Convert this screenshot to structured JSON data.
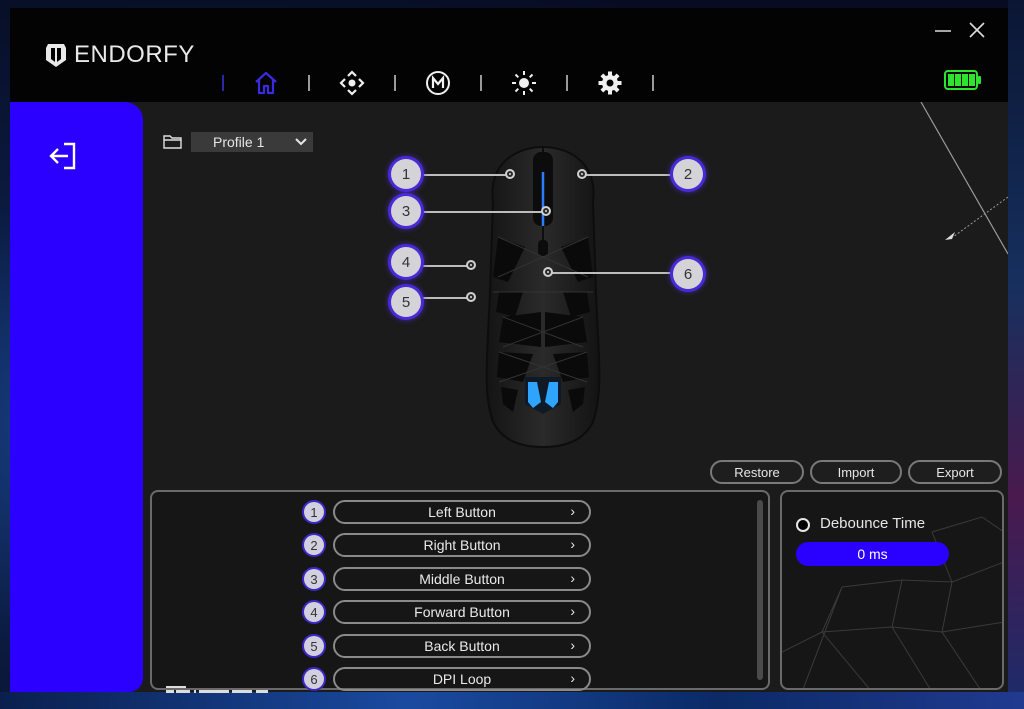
{
  "app": {
    "brand_name": "ENDORFY",
    "window_controls": {
      "minimize": "minimize-icon",
      "close": "close-icon"
    },
    "battery": {
      "icon": "battery-icon",
      "level_bars": 4,
      "level_total": 4,
      "color": "#2ee52e"
    }
  },
  "nav": {
    "items": [
      {
        "id": "home",
        "icon": "home-icon",
        "active": true
      },
      {
        "id": "dpi",
        "icon": "dpi-move-icon",
        "active": false
      },
      {
        "id": "macro",
        "icon": "macro-m-icon",
        "active": false
      },
      {
        "id": "lighting",
        "icon": "brightness-icon",
        "active": false
      },
      {
        "id": "settings",
        "icon": "gear-icon",
        "active": false
      }
    ],
    "active_color": "#3a2be0"
  },
  "sidebar": {
    "exit_icon": "exit-icon",
    "color": "#2b00ff"
  },
  "profile": {
    "icon": "folder-icon",
    "selected": "Profile 1"
  },
  "mouse_callouts": [
    "1",
    "2",
    "3",
    "4",
    "5",
    "6"
  ],
  "actions": {
    "restore": "Restore",
    "import": "Import",
    "export": "Export"
  },
  "mapping": {
    "rows": [
      {
        "num": "1",
        "label": "Left Button"
      },
      {
        "num": "2",
        "label": "Right Button"
      },
      {
        "num": "3",
        "label": "Middle Button"
      },
      {
        "num": "4",
        "label": "Forward Button"
      },
      {
        "num": "5",
        "label": "Back Button"
      },
      {
        "num": "6",
        "label": "DPI Loop"
      }
    ],
    "chevron": "›"
  },
  "debounce": {
    "label": "Debounce Time",
    "value": "0 ms"
  }
}
